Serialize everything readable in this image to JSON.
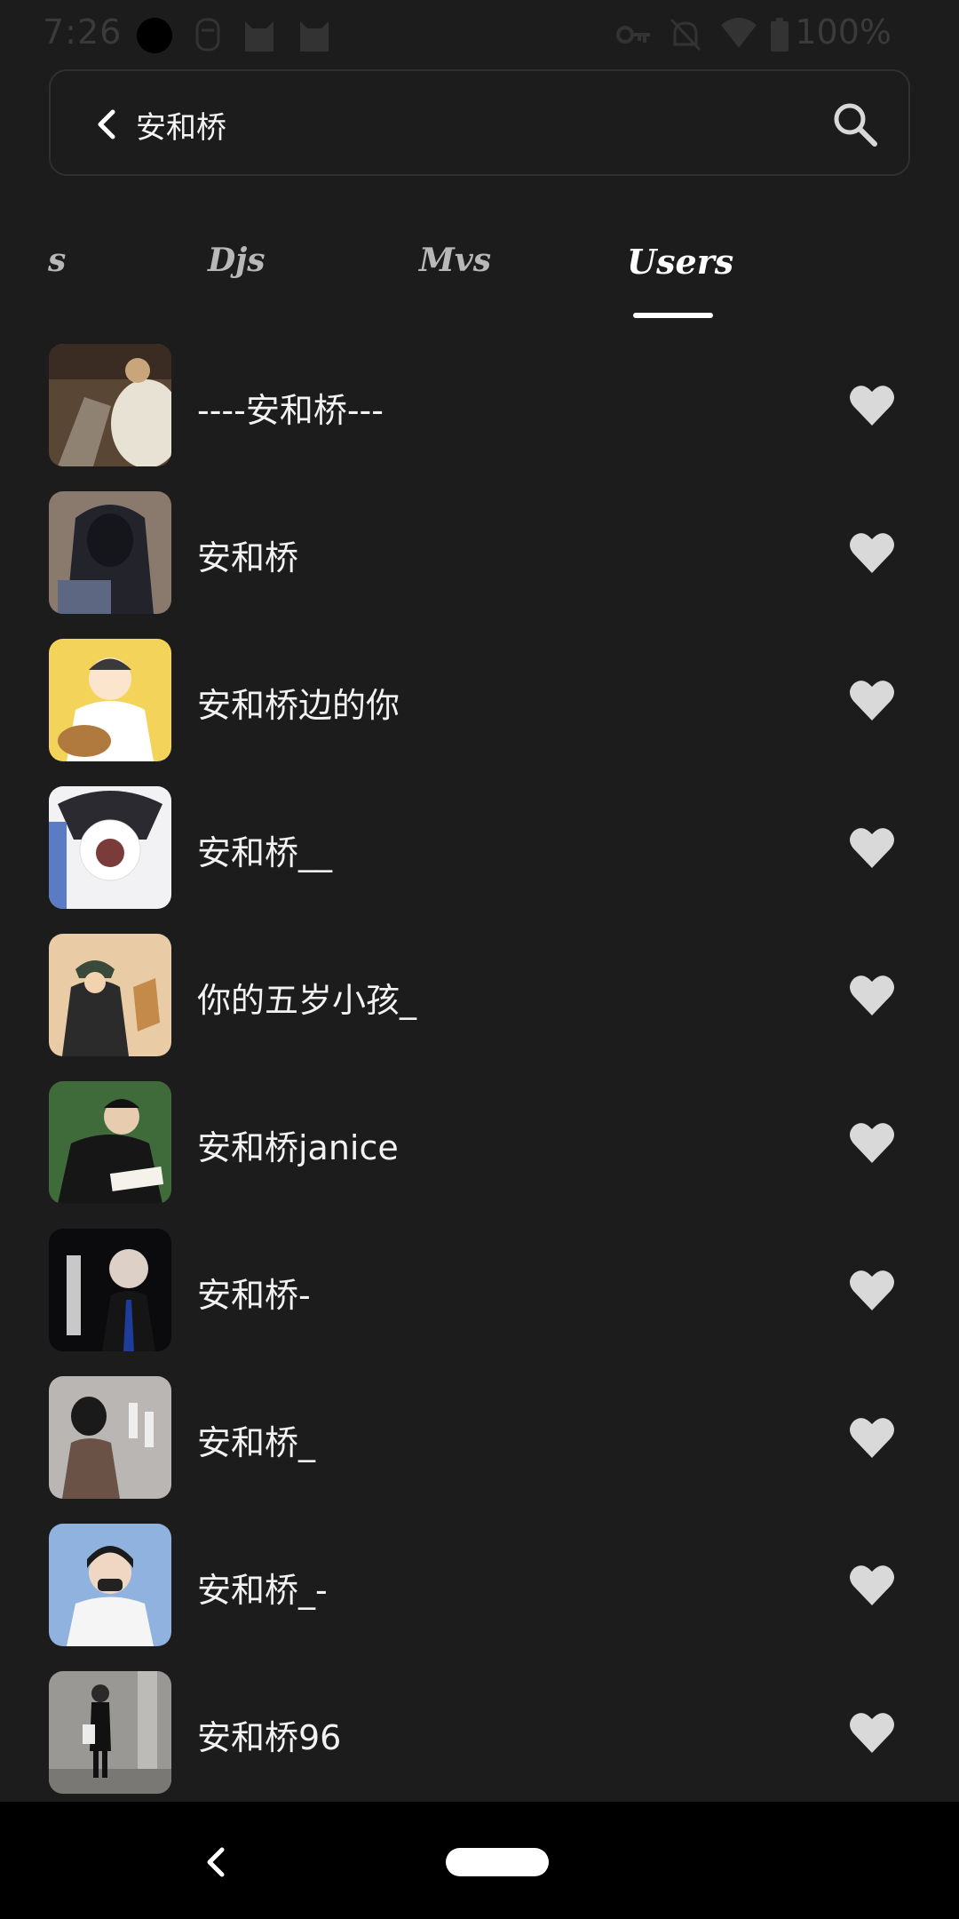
{
  "status_bar": {
    "time": "7:26",
    "battery": "100%",
    "icons": [
      "record-icon",
      "face-icon",
      "cat-icon",
      "cat-icon",
      "key-icon",
      "mute-icon",
      "wifi-icon",
      "battery-icon"
    ]
  },
  "search": {
    "query": "安和桥",
    "back_icon": "chevron-left-icon",
    "search_icon": "search-icon"
  },
  "tabs": [
    {
      "label": "s",
      "active": false
    },
    {
      "label": "Djs",
      "active": false
    },
    {
      "label": "Mvs",
      "active": false
    },
    {
      "label": "Users",
      "active": true
    }
  ],
  "users": [
    {
      "name": "----安和桥---",
      "liked_icon": "heart-icon"
    },
    {
      "name": "安和桥",
      "liked_icon": "heart-icon"
    },
    {
      "name": "安和桥边的你",
      "liked_icon": "heart-icon"
    },
    {
      "name": "安和桥__",
      "liked_icon": "heart-icon"
    },
    {
      "name": "你的五岁小孩_",
      "liked_icon": "heart-icon"
    },
    {
      "name": "安和桥janice",
      "liked_icon": "heart-icon"
    },
    {
      "name": "安和桥-",
      "liked_icon": "heart-icon"
    },
    {
      "name": "安和桥_",
      "liked_icon": "heart-icon"
    },
    {
      "name": "安和桥_-",
      "liked_icon": "heart-icon"
    },
    {
      "name": "安和桥96",
      "liked_icon": "heart-icon"
    }
  ],
  "colors": {
    "background": "#1c1c1d",
    "text": "#f2f2f2",
    "heart": "#d9d9d9",
    "tab_inactive": "#b8b8b8",
    "tab_active": "#ffffff"
  }
}
